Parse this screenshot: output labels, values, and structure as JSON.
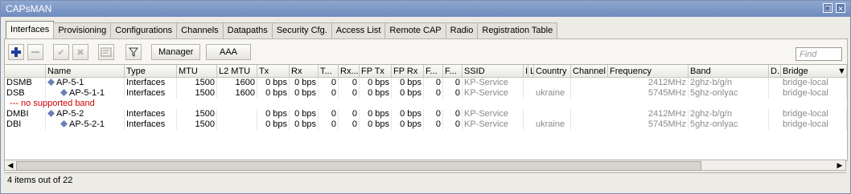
{
  "window": {
    "title": "CAPsMAN"
  },
  "tabs": [
    {
      "label": "Interfaces"
    },
    {
      "label": "Provisioning"
    },
    {
      "label": "Configurations"
    },
    {
      "label": "Channels"
    },
    {
      "label": "Datapaths"
    },
    {
      "label": "Security Cfg."
    },
    {
      "label": "Access List"
    },
    {
      "label": "Remote CAP"
    },
    {
      "label": "Radio"
    },
    {
      "label": "Registration Table"
    }
  ],
  "toolbar": {
    "manager_label": "Manager",
    "aaa_label": "AAA",
    "find_placeholder": "Find"
  },
  "table": {
    "headers": [
      "",
      "Name",
      "Type",
      "MTU",
      "L2 MTU",
      "Tx",
      "Rx",
      "T...",
      "Rx...",
      "FP Tx",
      "FP Rx",
      "F...",
      "F...",
      "SSID",
      "I",
      "L",
      "Country",
      "Channel",
      "Frequency",
      "Band",
      "D.",
      "Bridge"
    ],
    "rows": [
      {
        "flags": "DSMB",
        "name": "AP-5-1",
        "type": "Interfaces",
        "mtu": "1500",
        "l2mtu": "1600",
        "tx": "0 bps",
        "rx": "0 bps",
        "t": "0",
        "rxp": "0",
        "fptx": "0 bps",
        "fprx": "0 bps",
        "f1": "0",
        "f2": "0",
        "ssid": "KP-Service",
        "country": "",
        "freq": "2412MHz",
        "band": "2ghz-b/g/n",
        "bridge": "bridge-local",
        "indent": 0
      },
      {
        "flags": "DSB",
        "name": "AP-5-1-1",
        "type": "Interfaces",
        "mtu": "1500",
        "l2mtu": "1600",
        "tx": "0 bps",
        "rx": "0 bps",
        "t": "0",
        "rxp": "0",
        "fptx": "0 bps",
        "fprx": "0 bps",
        "f1": "0",
        "f2": "0",
        "ssid": "KP-Service",
        "country": "ukraine",
        "freq": "5745MHz",
        "band": "5ghz-onlyac",
        "bridge": "bridge-local",
        "indent": 1
      },
      {
        "comment": "--- no supported band"
      },
      {
        "flags": "DMBI",
        "name": "AP-5-2",
        "type": "Interfaces",
        "mtu": "1500",
        "l2mtu": "",
        "tx": "0 bps",
        "rx": "0 bps",
        "t": "0",
        "rxp": "0",
        "fptx": "0 bps",
        "fprx": "0 bps",
        "f1": "0",
        "f2": "0",
        "ssid": "KP-Service",
        "country": "",
        "freq": "2412MHz",
        "band": "2ghz-b/g/n",
        "bridge": "bridge-local",
        "indent": 0
      },
      {
        "flags": "DBI",
        "name": "AP-5-2-1",
        "type": "Interfaces",
        "mtu": "1500",
        "l2mtu": "",
        "tx": "0 bps",
        "rx": "0 bps",
        "t": "0",
        "rxp": "0",
        "fptx": "0 bps",
        "fprx": "0 bps",
        "f1": "0",
        "f2": "0",
        "ssid": "KP-Service",
        "country": "ukraine",
        "freq": "5745MHz",
        "band": "5ghz-onlyac",
        "bridge": "bridge-local",
        "indent": 1
      }
    ]
  },
  "status": {
    "text": "4 items out of 22"
  },
  "icons": {
    "add": "plus-icon",
    "remove": "minus-icon",
    "enable": "check-icon",
    "disable": "cross-icon",
    "comment": "note-icon",
    "filter": "filter-icon",
    "restore": "restore-icon",
    "close": "close-icon",
    "interface": "diamond-arrows-icon"
  },
  "colors": {
    "accent": "#1f3f9a",
    "comment": "#d10000",
    "disabled_text": "#8a8a8a"
  }
}
